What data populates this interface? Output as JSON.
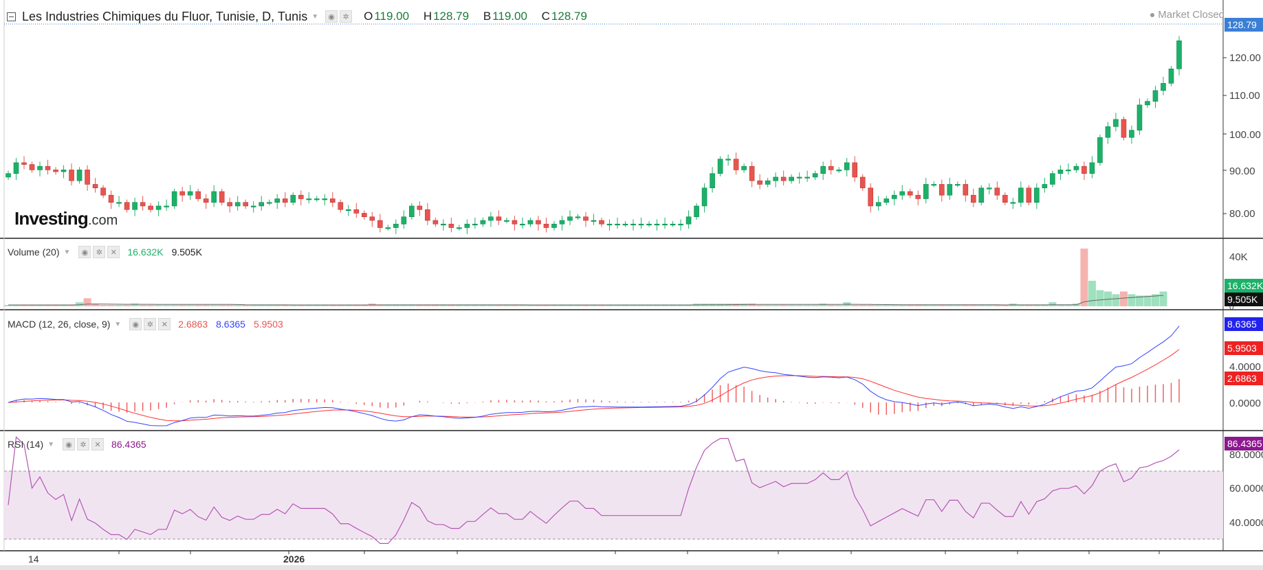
{
  "header": {
    "symbol_title": "Les Industries Chimiques du Fluor, Tunisie, D, Tunis",
    "open_label": "O",
    "open": "119.00",
    "high_label": "H",
    "high": "128.79",
    "low_label": "B",
    "low": "119.00",
    "close_label": "C",
    "close": "128.79",
    "market_status": "Market Closed"
  },
  "logo": {
    "main": "Investing",
    "suffix": ".com"
  },
  "price_axis": {
    "ticks": [
      "80.00",
      "90.00",
      "100.00",
      "110.00",
      "120.00"
    ],
    "last_tag": "128.79"
  },
  "volume_panel": {
    "title": "Volume (20)",
    "value1": "16.632K",
    "value2": "9.505K",
    "axis_ticks": [
      "40K",
      "0"
    ],
    "tag_volume": "16.632K",
    "tag_ma": "9.505K"
  },
  "macd_panel": {
    "title": "MACD (12, 26, close, 9)",
    "value_hist": "2.6863",
    "value_macd": "8.6365",
    "value_signal": "5.9503",
    "axis_ticks": [
      "4.0000",
      "0.0000"
    ],
    "tag_macd": "8.6365",
    "tag_signal": "5.9503",
    "tag_hist": "2.6863"
  },
  "rsi_panel": {
    "title": "RSI (14)",
    "value": "86.4365",
    "axis_ticks": [
      "80.0000",
      "60.0000",
      "40.0000"
    ],
    "tag": "86.4365"
  },
  "x_axis": {
    "labels": [
      "14",
      "2026"
    ]
  },
  "colors": {
    "up": "#1cb169",
    "down": "#e9544f",
    "volume_up": "#9fe0bf",
    "volume_down": "#f5b3b0",
    "macd_line": "#3342ff",
    "signal_line": "#ff3030",
    "rsi_line": "#b456b4",
    "rsi_band": "#f1e4f1",
    "last_price_tag": "#3a7fd5",
    "rsi_tag": "#8d178d"
  },
  "icons": {
    "collapse": "minus-square-icon",
    "visibility": "eye-icon",
    "settings": "gear-icon",
    "close": "close-icon"
  },
  "chart_data": [
    {
      "type": "candlestick",
      "title": "Les Industries Chimiques du Fluor, Tunisie, D, Tunis",
      "ylim": [
        75,
        133
      ],
      "x_labels": [
        "14",
        "2026"
      ],
      "closes": [
        92,
        95,
        94.5,
        93,
        94,
        93,
        92.5,
        93,
        90,
        93,
        89,
        88,
        86,
        84,
        84,
        82,
        84,
        83,
        82,
        83,
        83,
        87,
        86,
        87,
        85,
        84,
        87,
        84,
        83,
        84,
        83,
        83,
        84,
        84,
        85,
        84,
        86,
        85,
        85,
        85,
        85,
        84,
        82,
        82,
        81,
        80,
        79,
        77,
        77,
        78,
        80,
        83,
        82,
        79,
        78,
        78,
        77,
        77,
        78,
        78,
        79,
        80,
        79,
        79,
        78,
        78,
        79,
        78,
        77,
        78,
        79,
        80,
        80,
        79,
        79,
        78,
        78,
        78,
        78,
        78,
        78,
        78,
        78,
        78,
        78,
        78,
        80,
        83,
        88,
        92,
        96,
        96,
        93,
        94,
        90,
        89,
        90,
        91,
        90,
        91,
        91,
        91,
        92,
        94,
        93,
        93,
        95,
        91,
        88,
        83,
        84,
        85,
        86,
        87,
        86,
        85,
        89,
        89,
        86,
        89,
        89,
        86,
        84,
        88,
        88,
        86,
        84,
        84,
        88,
        84,
        88,
        89,
        92,
        93,
        93,
        94,
        92,
        95,
        102,
        105,
        107,
        102,
        104,
        111,
        112,
        115,
        117,
        121,
        128.79
      ],
      "volumes_k": [
        1,
        1,
        1,
        1,
        1,
        1,
        1,
        1,
        1,
        3,
        6,
        2,
        1,
        1,
        1,
        1,
        2,
        1,
        1,
        1,
        1,
        1,
        1,
        1,
        1,
        1,
        1,
        1,
        1,
        1,
        1,
        1,
        1,
        1,
        1,
        1,
        1,
        1,
        1,
        1,
        1,
        1,
        1,
        1,
        1,
        1,
        2,
        1,
        1,
        1,
        1,
        1,
        1,
        1,
        1,
        1,
        1,
        1,
        1,
        1,
        1,
        1,
        1,
        1,
        1,
        1,
        1,
        1,
        1,
        1,
        1,
        1,
        1,
        1,
        1,
        1,
        1,
        1,
        1,
        1,
        1,
        1,
        1,
        1,
        1,
        1,
        1,
        2,
        2,
        2,
        2,
        2,
        2,
        2,
        2,
        1,
        1,
        1,
        1,
        1,
        1,
        1,
        1,
        2,
        1,
        1,
        3,
        1,
        1,
        1,
        1,
        1,
        1,
        1,
        1,
        1,
        1,
        1,
        1,
        1,
        1,
        1,
        1,
        1,
        1,
        1,
        1,
        2,
        1,
        1,
        1,
        1,
        3,
        1,
        1,
        2,
        43,
        19,
        12,
        11,
        9,
        11,
        9,
        8,
        8,
        9,
        11
      ]
    },
    {
      "type": "line",
      "title": "MACD (12, 26, close, 9)",
      "series": [
        {
          "name": "MACD",
          "last": 8.6365
        },
        {
          "name": "Signal",
          "last": 5.9503
        },
        {
          "name": "Histogram",
          "last": 2.6863
        }
      ],
      "ylim": [
        -3,
        10
      ]
    },
    {
      "type": "line",
      "title": "RSI (14)",
      "series": [
        {
          "name": "RSI",
          "last": 86.4365
        }
      ],
      "ylim": [
        25,
        90
      ],
      "band": [
        30,
        70
      ]
    }
  ]
}
